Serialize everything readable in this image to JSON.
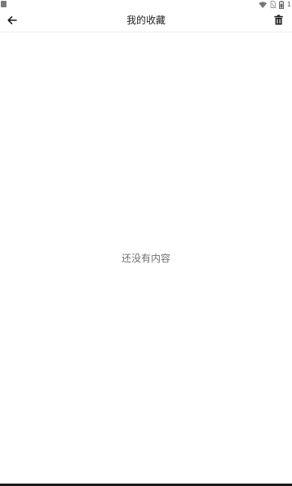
{
  "status_bar": {
    "time": "1"
  },
  "app_bar": {
    "title": "我的收藏"
  },
  "empty_state": {
    "message": "还没有内容"
  }
}
